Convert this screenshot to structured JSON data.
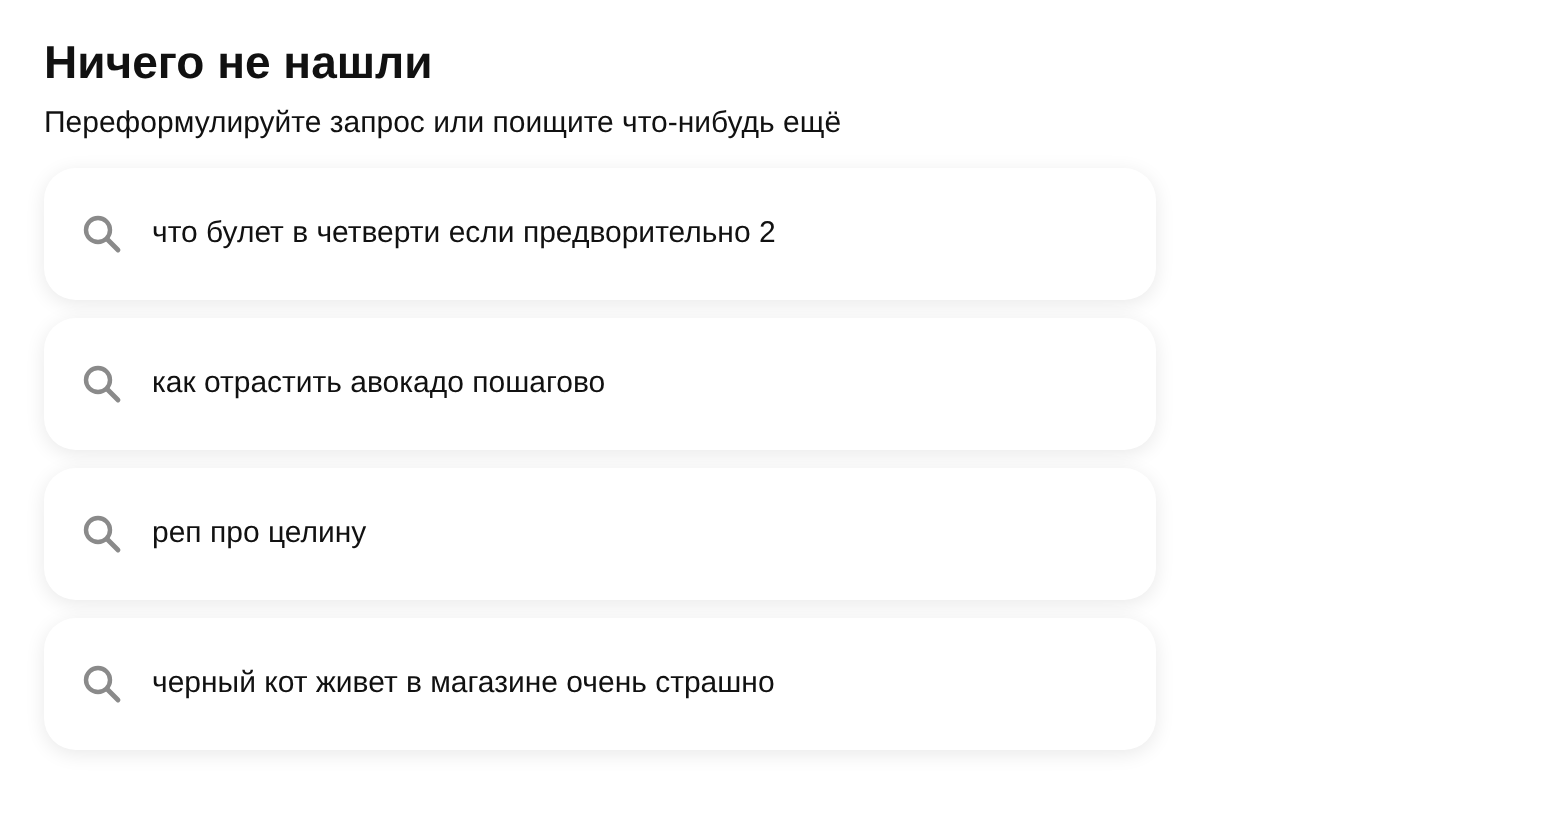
{
  "title": "Ничего не нашли",
  "subtitle": "Переформулируйте запрос или поищите что-нибудь ещё",
  "suggestions": [
    {
      "text": "что булет в четверти если предворительно 2"
    },
    {
      "text": "как отрастить авокадо пошагово"
    },
    {
      "text": "реп про целину"
    },
    {
      "text": "черный кот живет в магазине очень страшно"
    }
  ]
}
